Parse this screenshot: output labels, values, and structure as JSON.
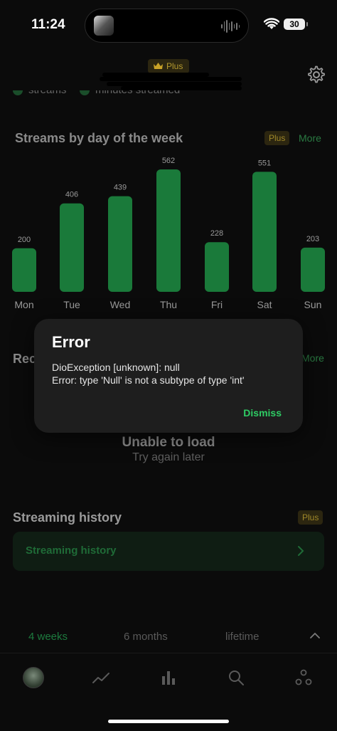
{
  "status_bar": {
    "time": "11:24",
    "battery": "30"
  },
  "header": {
    "plus_badge": "Plus"
  },
  "legend": {
    "item1": "streams",
    "item2": "minutes streamed"
  },
  "streams_section": {
    "title": "Streams by day of the week",
    "plus_badge": "Plus",
    "more": "More"
  },
  "chart_data": {
    "type": "bar",
    "categories": [
      "Mon",
      "Tue",
      "Wed",
      "Thu",
      "Fri",
      "Sat",
      "Sun"
    ],
    "values": [
      200,
      406,
      439,
      562,
      228,
      551,
      203
    ],
    "bar_color": "#1a7a3a"
  },
  "recent_section": {
    "title_partial": "Rec",
    "more": "More"
  },
  "error_state": {
    "title": "Unable to load",
    "subtitle": "Try again later"
  },
  "history_section": {
    "title": "Streaming history",
    "plus_badge": "Plus",
    "row_label": "Streaming history"
  },
  "range_tabs": [
    "4 weeks",
    "6 months",
    "lifetime"
  ],
  "dialog": {
    "title": "Error",
    "line1": "DioException [unknown]: null",
    "line2": "Error: type 'Null' is not a subtype of type 'int'",
    "dismiss": "Dismiss"
  },
  "nav": [
    "profile",
    "trend-icon",
    "bar-chart-icon",
    "search-icon",
    "friends-icon"
  ],
  "colors": {
    "accent": "#2ecc64",
    "plus_gold": "#b59a2e",
    "background": "#0b0b0b"
  }
}
